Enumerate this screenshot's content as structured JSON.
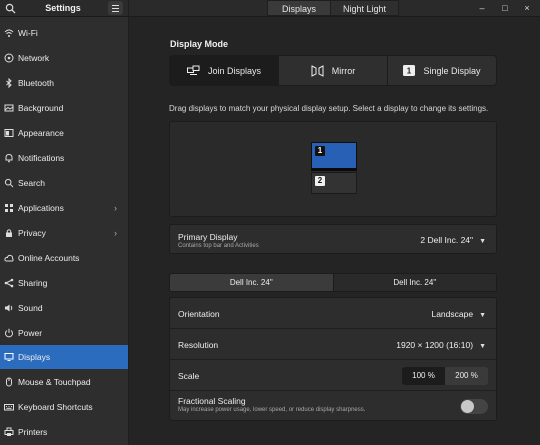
{
  "header": {
    "title": "Settings",
    "tabs": [
      "Displays",
      "Night Light"
    ],
    "controls": {
      "minimize": "–",
      "maximize": "□",
      "close": "×"
    }
  },
  "sidebar": {
    "items": [
      {
        "label": "Wi-Fi",
        "icon": "wifi-icon"
      },
      {
        "label": "Network",
        "icon": "network-icon"
      },
      {
        "label": "Bluetooth",
        "icon": "bluetooth-icon"
      },
      {
        "label": "Background",
        "icon": "background-icon"
      },
      {
        "label": "Appearance",
        "icon": "appearance-icon"
      },
      {
        "label": "Notifications",
        "icon": "bell-icon"
      },
      {
        "label": "Search",
        "icon": "search-icon"
      },
      {
        "label": "Applications",
        "icon": "apps-icon",
        "chevron": "›"
      },
      {
        "label": "Privacy",
        "icon": "privacy-icon",
        "chevron": "›"
      },
      {
        "label": "Online Accounts",
        "icon": "cloud-icon"
      },
      {
        "label": "Sharing",
        "icon": "share-icon"
      },
      {
        "label": "Sound",
        "icon": "speaker-icon"
      },
      {
        "label": "Power",
        "icon": "power-icon"
      },
      {
        "label": "Displays",
        "icon": "display-icon",
        "active": true
      },
      {
        "label": "Mouse & Touchpad",
        "icon": "mouse-icon"
      },
      {
        "label": "Keyboard Shortcuts",
        "icon": "keyboard-icon"
      },
      {
        "label": "Printers",
        "icon": "printer-icon"
      }
    ]
  },
  "main": {
    "display_mode_title": "Display Mode",
    "modes": [
      {
        "label": "Join Displays",
        "icon": "join-displays-icon",
        "active": true
      },
      {
        "label": "Mirror",
        "icon": "mirror-icon"
      },
      {
        "label": "Single Display",
        "icon": "single-display-icon"
      }
    ],
    "hint": "Drag displays to match your physical display setup. Select a display to change its settings.",
    "monitors": [
      {
        "num": "1",
        "selected": true
      },
      {
        "num": "2"
      }
    ],
    "primary": {
      "title": "Primary Display",
      "subtitle": "Contains top bar and Activities",
      "value": "2   Dell Inc. 24\""
    },
    "monitor_tabs": [
      "Dell Inc. 24\"",
      "Dell Inc. 24\""
    ],
    "orientation": {
      "label": "Orientation",
      "value": "Landscape"
    },
    "resolution": {
      "label": "Resolution",
      "value": "1920 × 1200 (16:10)"
    },
    "scale": {
      "label": "Scale",
      "options": [
        "100 %",
        "200 %"
      ],
      "selected": "100 %"
    },
    "fractional": {
      "title": "Fractional Scaling",
      "subtitle": "May increase power usage, lower speed, or reduce display sharpness.",
      "enabled": false
    }
  },
  "colors": {
    "accent": "#2c6cbf",
    "monitor_selected": "#2760b5"
  }
}
